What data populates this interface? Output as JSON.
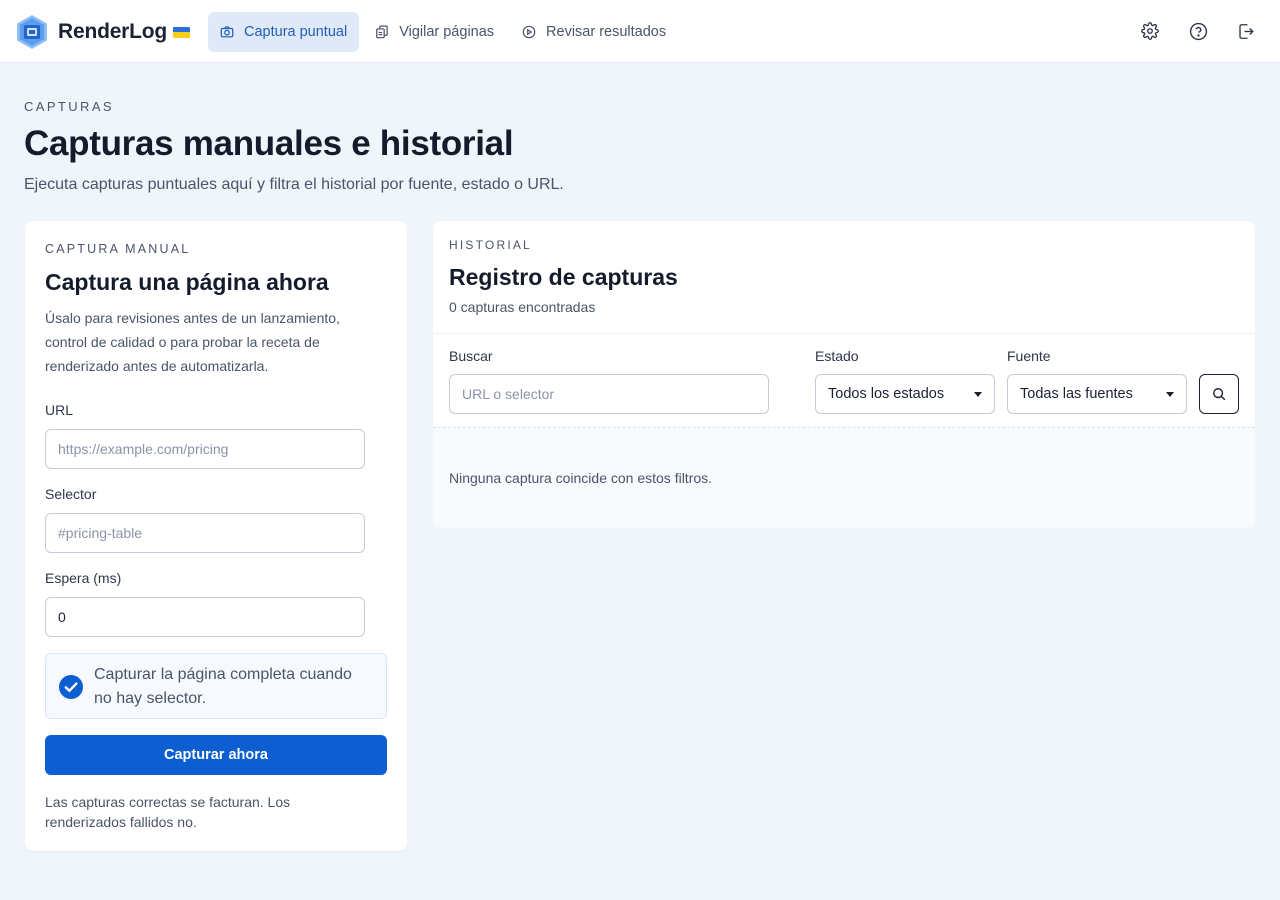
{
  "brand": {
    "name": "RenderLog",
    "flag_colors": [
      "#2d6fd6",
      "#f5cd1c"
    ],
    "logo_colors": [
      "#5fa1f0",
      "#2563c9"
    ]
  },
  "nav": {
    "items": [
      {
        "label": "Captura puntual",
        "icon": "camera-icon",
        "active": true
      },
      {
        "label": "Vigilar páginas",
        "icon": "copy-pages-icon",
        "active": false
      },
      {
        "label": "Revisar resultados",
        "icon": "play-circle-icon",
        "active": false
      }
    ],
    "actions": [
      "settings-icon",
      "help-icon",
      "logout-icon"
    ]
  },
  "page": {
    "eyebrow": "CAPTURAS",
    "title": "Capturas manuales e historial",
    "subtitle": "Ejecuta capturas puntuales aquí y filtra el historial por fuente, estado o URL."
  },
  "manual": {
    "eyebrow": "CAPTURA MANUAL",
    "title": "Captura una página ahora",
    "description": "Úsalo para revisiones antes de un lanzamiento, control de calidad o para probar la receta de renderizado antes de automatizarla.",
    "url_label": "URL",
    "url_placeholder": "https://example.com/pricing",
    "selector_label": "Selector",
    "selector_placeholder": "#pricing-table",
    "wait_label": "Espera (ms)",
    "wait_value": "0",
    "fullpage_checked": true,
    "fullpage_label": "Capturar la página completa cuando no hay selector.",
    "submit_label": "Capturar ahora",
    "footnote": "Las capturas correctas se facturan. Los renderizados fallidos no."
  },
  "history": {
    "eyebrow": "HISTORIAL",
    "title": "Registro de capturas",
    "count": "0 capturas encontradas",
    "search_label": "Buscar",
    "search_placeholder": "URL o selector",
    "status_label": "Estado",
    "status_value": "Todos los estados",
    "source_label": "Fuente",
    "source_value": "Todas las fuentes",
    "empty_message": "Ninguna captura coincide con estos filtros."
  },
  "colors": {
    "accent": "#0d5fd1",
    "nav_active_bg": "#dfe9f8",
    "page_bg": "#f0f4fb"
  }
}
